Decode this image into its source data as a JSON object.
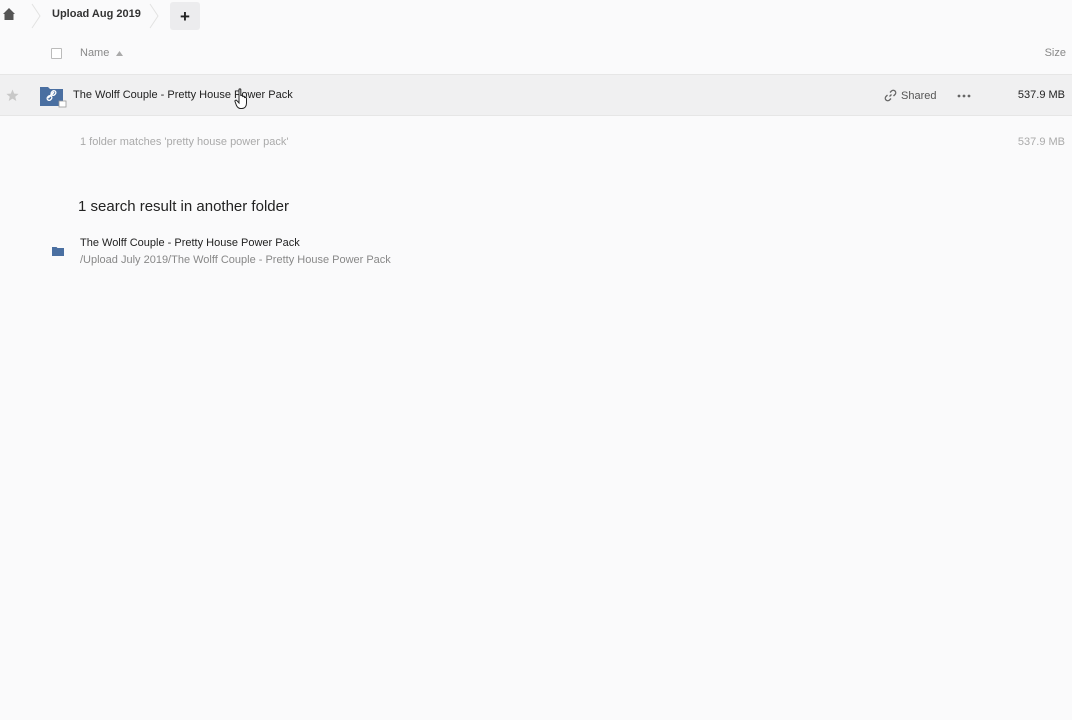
{
  "breadcrumb": {
    "home_icon": "home-icon",
    "current": "Upload Aug 2019",
    "new_button_glyph": "+"
  },
  "header": {
    "name_label": "Name",
    "size_label": "Size"
  },
  "file": {
    "name": "The Wolff Couple - Pretty House Power Pack",
    "share_label": "Shared",
    "size": "537.9 MB"
  },
  "summary": {
    "text": "1 folder matches 'pretty house power pack'",
    "size": "537.9 MB"
  },
  "other_results": {
    "title": "1 search result in another folder",
    "items": [
      {
        "name": "The Wolff Couple - Pretty House Power Pack",
        "path": "/Upload July 2019/The Wolff Couple - Pretty House Power Pack"
      }
    ]
  },
  "colors": {
    "background": "#fafafb",
    "folder": "#4a6fa1",
    "row_highlight": "#f0f0f1"
  }
}
